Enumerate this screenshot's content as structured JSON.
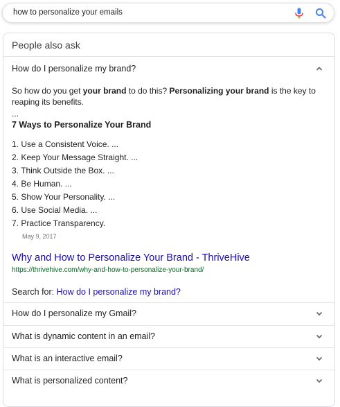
{
  "search": {
    "query": "how to personalize your emails",
    "mic_icon": "microphone-icon",
    "search_icon": "magnifier-icon",
    "colors": {
      "mic": [
        "#4285f4",
        "#ea4335",
        "#fbbc05",
        "#34a853"
      ],
      "magnifier": "#4285f4"
    }
  },
  "paa": {
    "title": "People also ask",
    "expanded": {
      "question": "How do I personalize my brand?",
      "snippet_prefix": "So how do you get ",
      "snippet_bold1": "your brand",
      "snippet_mid": " to do this? ",
      "snippet_bold2": "Personalizing your brand",
      "snippet_suffix": " is the key to reaping its benefits.",
      "ellipsis": "...",
      "list_heading": "7 Ways to Personalize Your Brand",
      "list": [
        "1. Use a Consistent Voice. ...",
        "2. Keep Your Message Straight. ...",
        "3. Think Outside the Box. ...",
        "4. Be Human. ...",
        "5. Show Your Personality. ...",
        "6. Use Social Media. ...",
        "7. Practice Transparency."
      ],
      "date": "May 9, 2017",
      "result_title": "Why and How to Personalize Your Brand - ThriveHive",
      "result_url": "https://thrivehive.com/why-and-how-to-personalize-your-brand/",
      "search_for_label": "Search for: ",
      "search_for_link": "How do I personalize my brand?",
      "link_color": "#1a0dab",
      "url_color": "#006621"
    },
    "questions": [
      "How do I personalize my Gmail?",
      "What is dynamic content in an email?",
      "What is an interactive email?",
      "What is personalized content?"
    ]
  }
}
